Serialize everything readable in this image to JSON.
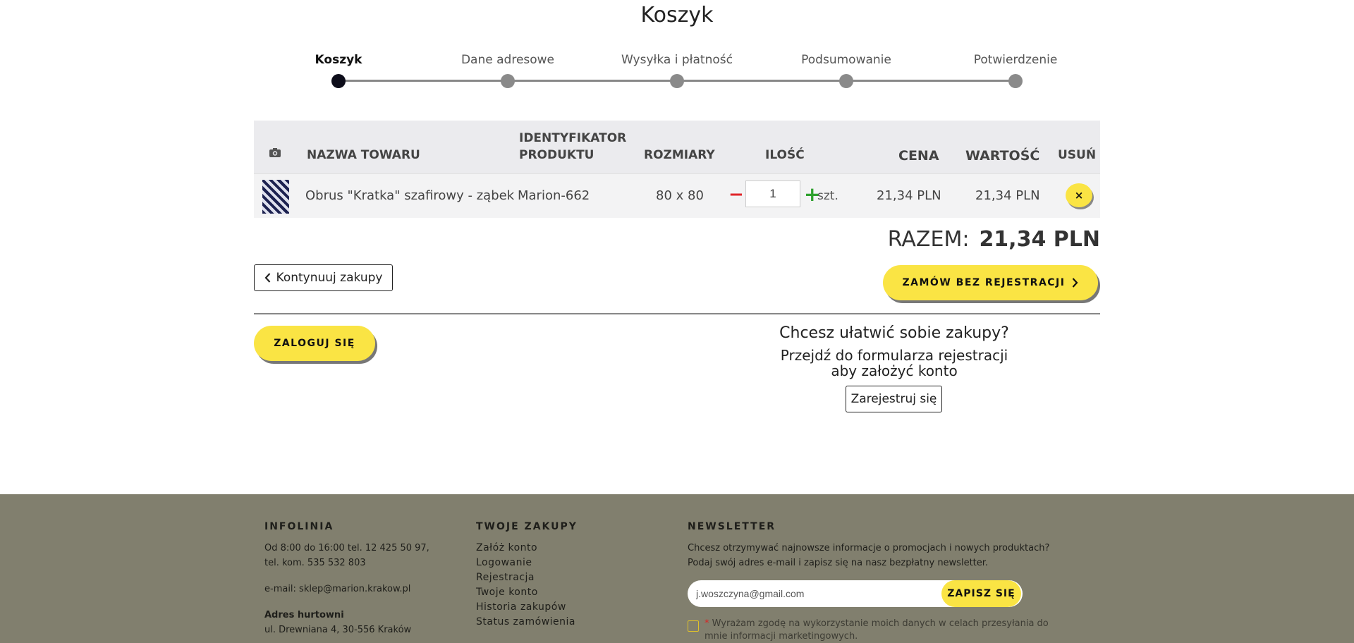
{
  "page_title": "Koszyk",
  "steps": [
    {
      "label": "Koszyk",
      "active": true
    },
    {
      "label": "Dane adresowe",
      "active": false
    },
    {
      "label": "Wysyłka i płatność",
      "active": false
    },
    {
      "label": "Podsumowanie",
      "active": false
    },
    {
      "label": "Potwierdzenie",
      "active": false
    }
  ],
  "table": {
    "headers": {
      "photo_icon": "camera-icon",
      "name": "NAZWA TOWARU",
      "product_id": "IDENTYFIKATOR PRODUKTU",
      "sizes": "ROZMIARY",
      "quantity": "ILOŚĆ",
      "price": "CENA",
      "value": "WARTOŚĆ",
      "remove": "USUŃ"
    },
    "rows": [
      {
        "name": "Obrus \"Kratka\" szafirowy - ząbek",
        "product_id": "Marion-662",
        "size": "80 x 80",
        "quantity": "1",
        "unit": "szt.",
        "price": "21,34 PLN",
        "value": "21,34 PLN",
        "remove_symbol": "×"
      }
    ]
  },
  "total": {
    "label": "RAZEM:",
    "value": "21,34 PLN"
  },
  "buttons": {
    "continue": "Kontynuuj zakupy",
    "order_no_registration": "ZAMÓW BEZ REJESTRACJI",
    "login": "ZALOGUJ SIĘ",
    "register": "Zarejestruj się"
  },
  "promo": {
    "heading": "Chcesz ułatwić sobie zakupy?",
    "line1": "Przejdź do formularza rejestracji",
    "line2": "aby założyć konto"
  },
  "footer": {
    "infolinia": {
      "title": "INFOLINIA",
      "hours": "Od 8:00 do 16:00 tel. 12 425 50 97,",
      "mobile": "tel. kom. 535 532 803",
      "email": "e-mail: sklep@marion.krakow.pl",
      "address_title": "Adres hurtowni",
      "address": "ul. Drewniana 4, 30-556 Kraków"
    },
    "zakupy": {
      "title": "TWOJE ZAKUPY",
      "links": [
        "Załóż konto",
        "Logowanie",
        "Rejestracja",
        "Twoje konto",
        "Historia zakupów",
        "Status zamówienia"
      ]
    },
    "newsletter": {
      "title": "NEWSLETTER",
      "text1": "Chcesz otrzymywać najnowsze informacje o promocjach i nowych produktach?",
      "text2": "Podaj swój adres e-mail i zapisz się na nasz bezpłatny newsletter.",
      "email_value": "j.woszczyna@gmail.com",
      "button": "ZAPISZ SIĘ",
      "consent_mark": "*",
      "consent": "Wyrażam zgodę na wykorzystanie moich danych w celach przesyłania do mnie informacji marketingowych."
    }
  }
}
